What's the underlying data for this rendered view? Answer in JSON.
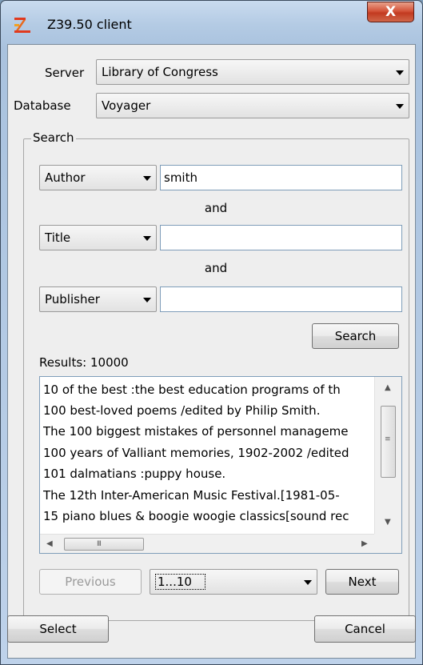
{
  "window": {
    "title": "Z39.50 client",
    "close_glyph": "X",
    "icon": "z3950-app-icon"
  },
  "server": {
    "label": "Server",
    "value": "Library of Congress"
  },
  "database": {
    "label": "Database",
    "value": "Voyager"
  },
  "search": {
    "group_title": "Search",
    "rows": [
      {
        "field": "Author",
        "value": "smith"
      },
      {
        "field": "Title",
        "value": ""
      },
      {
        "field": "Publisher",
        "value": ""
      }
    ],
    "connectors": [
      "and",
      "and"
    ],
    "button_label": "Search"
  },
  "results": {
    "label": "Results: 10000",
    "items": [
      "10 of the best :the best education programs of th",
      "100 best-loved poems /edited by Philip Smith.",
      "The 100 biggest mistakes of personnel manageme",
      "100 years of Valliant memories, 1902-2002 /edited",
      "101 dalmatians :puppy house.",
      "The 12th Inter-American Music Festival.[1981-05-",
      "15 piano blues & boogie woogie classics[sound rec"
    ],
    "hscroll_grip": "III"
  },
  "paging": {
    "previous_label": "Previous",
    "range_value": "1...10",
    "next_label": "Next"
  },
  "footer": {
    "select_label": "Select",
    "cancel_label": "Cancel"
  },
  "colors": {
    "title_bar": "#b4cbe4",
    "close_button": "#c23a20",
    "client_bg": "#eeeeee",
    "field_border": "#7f9db9"
  }
}
